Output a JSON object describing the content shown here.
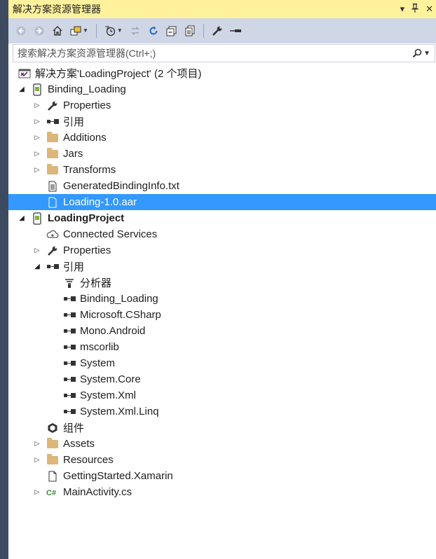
{
  "window": {
    "title": "解决方案资源管理器",
    "controls": [
      "▾",
      "ᵖ",
      "✕"
    ]
  },
  "search": {
    "placeholder": "搜索解决方案资源管理器(Ctrl+;)"
  },
  "colors": {
    "title_bg": "#fff29d",
    "toolbar_bg": "#cfd6e5",
    "selection": "#3399ff",
    "folder": "#dcb67a",
    "left_strip": "#3d4a5f"
  },
  "tree": {
    "solution": "解决方案'LoadingProject' (2 个项目)",
    "binding_loading": {
      "name": "Binding_Loading",
      "properties": "Properties",
      "references": "引用",
      "additions": "Additions",
      "jars": "Jars",
      "transforms": "Transforms",
      "generated_info": "GeneratedBindingInfo.txt",
      "aar": "Loading-1.0.aar"
    },
    "loading_project": {
      "name": "LoadingProject",
      "connected_services": "Connected Services",
      "properties": "Properties",
      "references": "引用",
      "refs": {
        "analyzers": "分析器",
        "binding_loading": "Binding_Loading",
        "microsoft_csharp": "Microsoft.CSharp",
        "mono_android": "Mono.Android",
        "mscorlib": "mscorlib",
        "system": "System",
        "system_core": "System.Core",
        "system_xml": "System.Xml",
        "system_xml_linq": "System.Xml.Linq"
      },
      "components": "组件",
      "assets": "Assets",
      "resources": "Resources",
      "getting_started": "GettingStarted.Xamarin",
      "main_activity": "MainActivity.cs"
    }
  }
}
